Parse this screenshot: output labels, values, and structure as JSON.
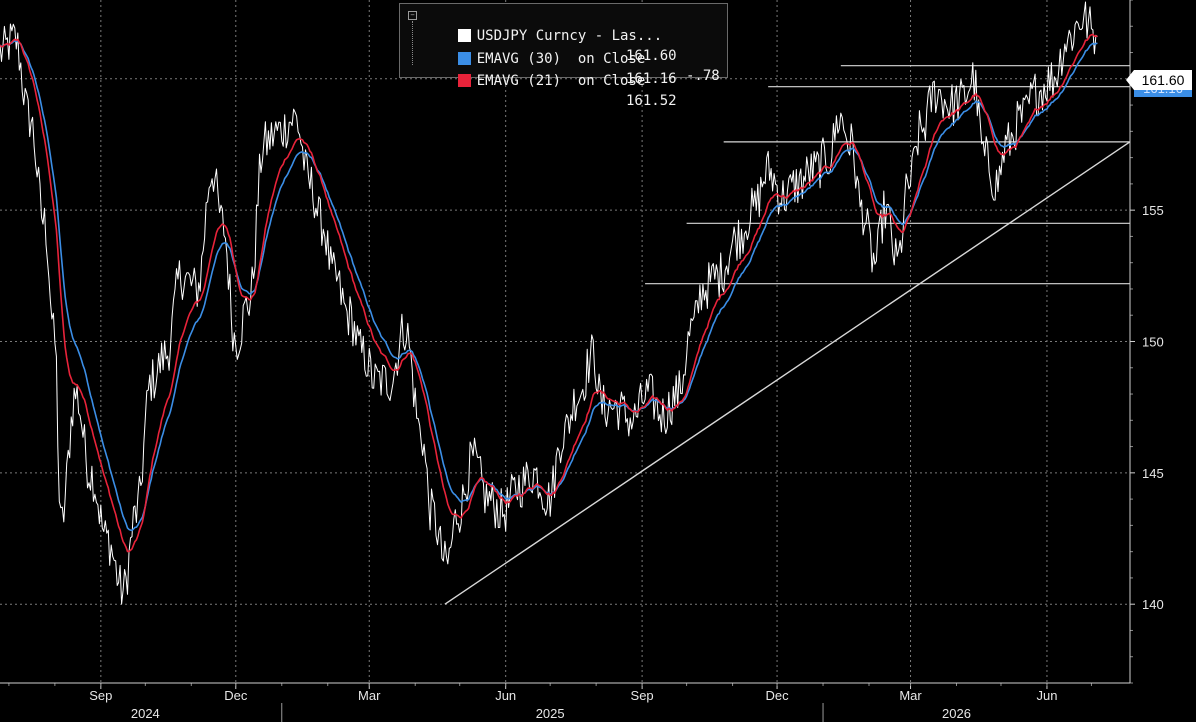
{
  "legend": {
    "items": [
      {
        "label": "USDJPY Curncy - Las...",
        "value": "161.60",
        "change": "-.78",
        "color": "#ffffff"
      },
      {
        "label": "EMAVG (30)  on Close",
        "value": "161.16",
        "change": "",
        "color": "#3b8ee6"
      },
      {
        "label": "EMAVG (21)  on Close",
        "value": "161.52",
        "change": "",
        "color": "#e8233a"
      }
    ]
  },
  "price_tags": {
    "last": "161.60",
    "ema": "161.16"
  },
  "chart_data": {
    "type": "line",
    "series_names": [
      "USDJPY Curncy - Las...",
      "EMAVG (30)  on Close",
      "EMAVG (21)  on Close"
    ],
    "y_ticks": [
      140,
      145,
      150,
      155,
      160
    ],
    "ylim": [
      137,
      163
    ],
    "x_month_labels": [
      {
        "label": "Sep",
        "date": "2024-09-01"
      },
      {
        "label": "Dec",
        "date": "2024-12-01"
      },
      {
        "label": "Mar",
        "date": "2025-03-01"
      },
      {
        "label": "Jun",
        "date": "2025-06-01"
      },
      {
        "label": "Sep",
        "date": "2025-09-01"
      },
      {
        "label": "Dec",
        "date": "2025-12-01"
      },
      {
        "label": "Mar",
        "date": "2026-03-01"
      },
      {
        "label": "Jun",
        "date": "2026-06-01"
      }
    ],
    "x_year_labels": [
      {
        "label": "2024",
        "date": "2024-10-01"
      },
      {
        "label": "2025",
        "date": "2025-07-01"
      },
      {
        "label": "2026",
        "date": "2026-04-01"
      }
    ],
    "xlim": [
      "2024-06-25",
      "2026-07-27"
    ],
    "price_keypoints": [
      [
        "2024-06-25",
        161.0
      ],
      [
        "2024-07-05",
        161.5
      ],
      [
        "2024-07-15",
        158.5
      ],
      [
        "2024-07-25",
        154.5
      ],
      [
        "2024-08-01",
        150.0
      ],
      [
        "2024-08-05",
        143.0
      ],
      [
        "2024-08-15",
        148.0
      ],
      [
        "2024-08-25",
        145.0
      ],
      [
        "2024-09-05",
        142.5
      ],
      [
        "2024-09-16",
        140.5
      ],
      [
        "2024-09-25",
        143.5
      ],
      [
        "2024-10-05",
        148.5
      ],
      [
        "2024-10-15",
        149.5
      ],
      [
        "2024-10-25",
        152.5
      ],
      [
        "2024-11-05",
        152.0
      ],
      [
        "2024-11-15",
        156.5
      ],
      [
        "2024-11-22",
        154.5
      ],
      [
        "2024-12-01",
        150.0
      ],
      [
        "2024-12-10",
        151.5
      ],
      [
        "2024-12-20",
        157.5
      ],
      [
        "2024-12-30",
        158.0
      ],
      [
        "2025-01-10",
        158.5
      ],
      [
        "2025-01-20",
        156.0
      ],
      [
        "2025-01-28",
        154.5
      ],
      [
        "2025-02-05",
        152.5
      ],
      [
        "2025-02-15",
        151.0
      ],
      [
        "2025-02-25",
        149.5
      ],
      [
        "2025-03-05",
        148.5
      ],
      [
        "2025-03-15",
        148.5
      ],
      [
        "2025-03-25",
        150.5
      ],
      [
        "2025-04-05",
        146.5
      ],
      [
        "2025-04-12",
        143.5
      ],
      [
        "2025-04-22",
        141.5
      ],
      [
        "2025-04-30",
        143.5
      ],
      [
        "2025-05-10",
        145.5
      ],
      [
        "2025-05-20",
        144.0
      ],
      [
        "2025-05-30",
        143.5
      ],
      [
        "2025-06-10",
        144.5
      ],
      [
        "2025-06-20",
        145.0
      ],
      [
        "2025-06-30",
        144.0
      ],
      [
        "2025-07-10",
        146.5
      ],
      [
        "2025-07-20",
        148.0
      ],
      [
        "2025-07-30",
        149.5
      ],
      [
        "2025-08-05",
        147.5
      ],
      [
        "2025-08-15",
        147.5
      ],
      [
        "2025-08-25",
        147.0
      ],
      [
        "2025-09-05",
        148.0
      ],
      [
        "2025-09-15",
        147.2
      ],
      [
        "2025-09-25",
        148.0
      ],
      [
        "2025-10-05",
        150.5
      ],
      [
        "2025-10-12",
        152.0
      ],
      [
        "2025-10-22",
        152.5
      ],
      [
        "2025-11-05",
        154.0
      ],
      [
        "2025-11-15",
        155.0
      ],
      [
        "2025-11-25",
        156.5
      ],
      [
        "2025-12-05",
        155.5
      ],
      [
        "2025-12-15",
        156.0
      ],
      [
        "2025-12-25",
        156.5
      ],
      [
        "2026-01-05",
        157.0
      ],
      [
        "2026-01-12",
        158.5
      ],
      [
        "2026-01-20",
        157.5
      ],
      [
        "2026-01-27",
        155.0
      ],
      [
        "2026-02-05",
        153.0
      ],
      [
        "2026-02-12",
        155.0
      ],
      [
        "2026-02-20",
        153.0
      ],
      [
        "2026-02-28",
        156.0
      ],
      [
        "2026-03-08",
        158.0
      ],
      [
        "2026-03-18",
        159.5
      ],
      [
        "2026-03-28",
        159.0
      ],
      [
        "2026-04-05",
        159.2
      ],
      [
        "2026-04-12",
        160.0
      ],
      [
        "2026-04-20",
        157.0
      ],
      [
        "2026-04-28",
        156.0
      ],
      [
        "2026-05-05",
        157.5
      ],
      [
        "2026-05-15",
        158.5
      ],
      [
        "2026-05-25",
        159.5
      ],
      [
        "2026-06-05",
        160.0
      ],
      [
        "2026-06-15",
        161.5
      ],
      [
        "2026-06-25",
        162.3
      ],
      [
        "2026-07-05",
        161.6
      ]
    ],
    "horizontal_levels": [
      {
        "y": 160.5,
        "from": "2026-01-13",
        "to": "2026-07-27"
      },
      {
        "y": 159.7,
        "from": "2025-11-25",
        "to": "2026-07-27"
      },
      {
        "y": 157.6,
        "from": "2025-10-26",
        "to": "2026-07-27"
      },
      {
        "y": 154.5,
        "from": "2025-10-01",
        "to": "2026-07-27"
      },
      {
        "y": 152.2,
        "from": "2025-09-03",
        "to": "2026-07-27"
      }
    ],
    "trendline": {
      "from": [
        "2025-04-21",
        140.0
      ],
      "to": [
        "2026-07-27",
        157.6
      ]
    },
    "colors": {
      "price": "#ffffff",
      "ema30": "#3b8ee6",
      "ema21": "#e8233a",
      "grid": "#7a7a7a"
    }
  }
}
